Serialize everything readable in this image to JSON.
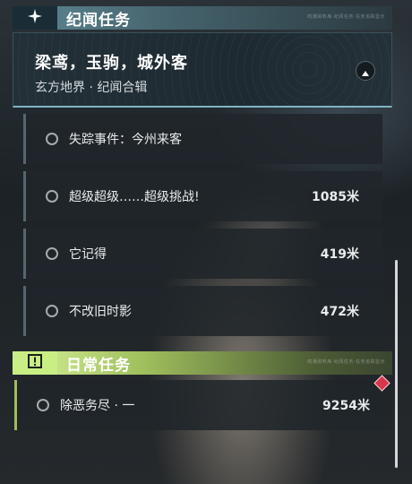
{
  "sections": {
    "story": {
      "title": "纪闻任务",
      "tiny_text": "鸣潮资料库·纪闻任务·任务追踪显示",
      "icon": "four-point-star-icon",
      "accent": "#5f8894"
    },
    "daily": {
      "title": "日常任务",
      "tiny_text": "鸣潮资料库·纪闻任务·任务追踪显示",
      "icon": "exclamation-box-icon",
      "accent": "#c9ef84"
    }
  },
  "banner": {
    "title": "梁鸢，玉驹，城外客",
    "subtitle": "玄方地界 · 纪闻合辑",
    "collapse_icon": "chevron-up-icon"
  },
  "story_quests": [
    {
      "name": "失踪事件：今州来客",
      "distance": ""
    },
    {
      "name": "超级超级……超级挑战!",
      "distance": "1085米"
    },
    {
      "name": "它记得",
      "distance": "419米"
    },
    {
      "name": "不改旧时影",
      "distance": "472米"
    }
  ],
  "daily_quests": [
    {
      "name": "除恶务尽 · 一",
      "distance": "9254米"
    }
  ],
  "marker": {
    "icon": "red-diamond-marker-icon",
    "color": "#d7364b"
  }
}
